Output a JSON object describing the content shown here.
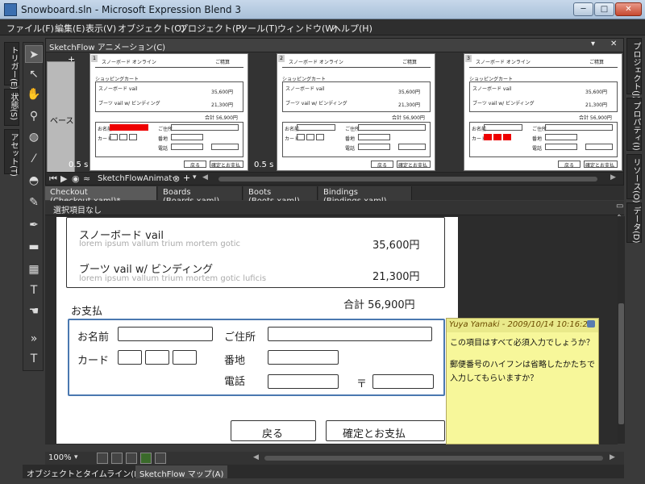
{
  "window": {
    "title": "Snowboard.sln - Microsoft Expression Blend 3",
    "min": "─",
    "max": "□",
    "close": "✕"
  },
  "menu": [
    "ファイル(F)",
    "編集(E)",
    "表示(V)",
    "オブジェクト(O)",
    "プロジェクト(P)",
    "ツール(T)",
    "ウィンドウ(W)",
    "ヘルプ(H)"
  ],
  "left_tabs": [
    "トリガー(E)",
    "状態(S)",
    "アセット(T)"
  ],
  "right_tabs": [
    "プロジェクト(J)",
    "プロパティ(I)",
    "リソース(O)",
    "データ(D)"
  ],
  "sketchflow": {
    "header": "SketchFlow アニメーション(C)",
    "base_label": "ベース",
    "plus": "+",
    "frames": [
      {
        "num": "1",
        "duration": "0.5 s",
        "red_field": true
      },
      {
        "num": "2",
        "duration": "0.5 s",
        "red_field": false
      },
      {
        "num": "3",
        "duration": "",
        "red_field": true
      }
    ],
    "frame_text": {
      "title": "スノーボード オンライン",
      "header_right": "ご精算",
      "cart": "ショッピングカート",
      "item1": "スノーボード vail",
      "item2": "ブーツ vail w/ ビンディング",
      "price1": "35,600円",
      "price2": "21,300円",
      "total": "合計 56,900円",
      "name": "お名前",
      "card": "カード",
      "addr": "ご住所",
      "banchi": "番地",
      "tel": "電話",
      "back": "戻る",
      "confirm": "確定とお支払"
    },
    "transport_label": "SketchFlowAnimat···"
  },
  "doc_tabs": [
    "Checkout (Checkout.xaml)*",
    "Boards (Boards.xaml)",
    "Boots (Boots.xaml)",
    "Bindings (Bindings.xaml)"
  ],
  "breadcrumb": "選択項目なし",
  "artboard": {
    "item1": {
      "name": "スノーボード vail",
      "desc": "lorem ipsum vallum trium mortem gotic",
      "price": "35,600円"
    },
    "item2": {
      "name": "ブーツ vail w/ ビンディング",
      "desc": "lorem ipsum vallum trium mortem gotic luficis",
      "price": "21,300円"
    },
    "total": "合計 56,900円",
    "payment_heading": "お支払",
    "name_label": "お名前",
    "card_label": "カード",
    "address_label": "ご住所",
    "banchi_label": "番地",
    "tel_label": "電話",
    "postal_label": "〒",
    "back_button": "戻る",
    "confirm_button": "確定とお支払"
  },
  "annotation": {
    "author_date": "Yuya Yamaki - 2009/10/14 10:16:22",
    "line1": "この項目はすべて必須入力でしょうか？",
    "line2": "郵便番号のハイフンは省略したかたちで入力してもらいますか？"
  },
  "zoom": "100%",
  "status_tabs": [
    "オブジェクトとタイムライン(B)",
    "SketchFlow マップ(A)"
  ]
}
